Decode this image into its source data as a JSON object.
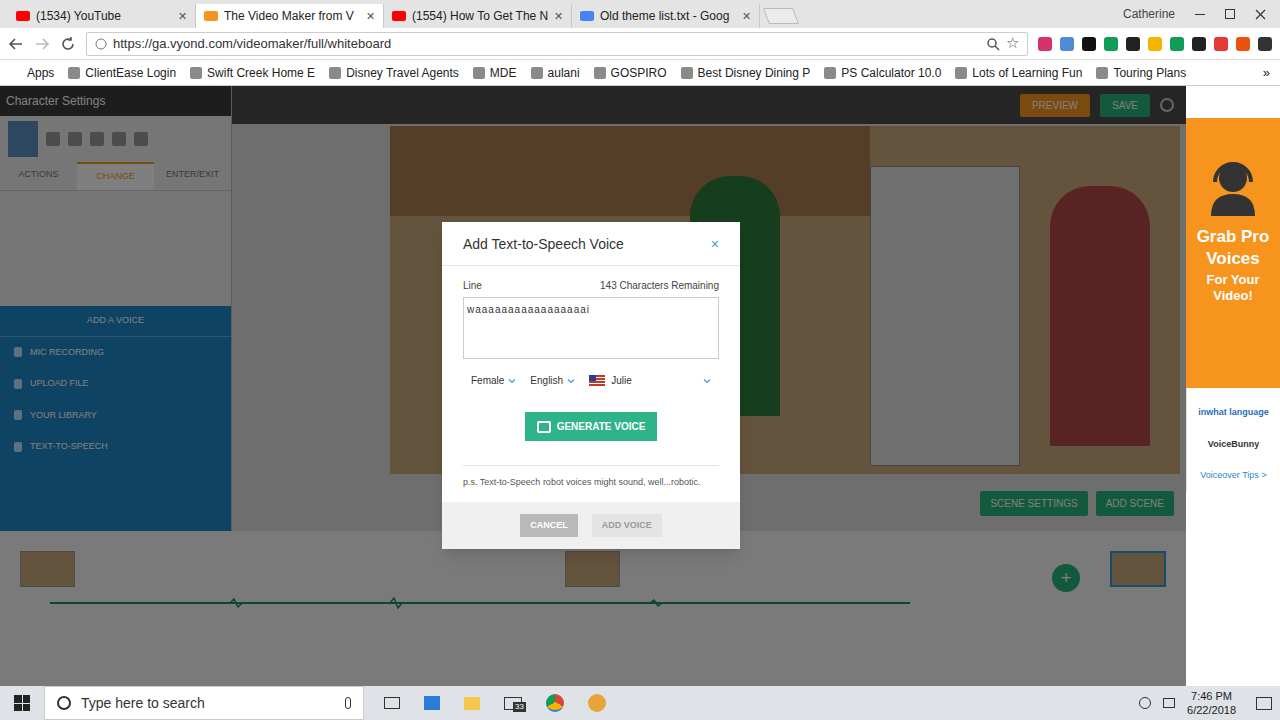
{
  "browser": {
    "tabs": [
      {
        "label": "(1534) YouTube",
        "selected": false
      },
      {
        "label": "The Video Maker from V",
        "selected": true
      },
      {
        "label": "(1554) How To Get The N",
        "selected": false
      },
      {
        "label": "Old theme list.txt - Goog",
        "selected": false
      }
    ],
    "profile": "Catherine",
    "url": "https://ga.vyond.com/videomaker/full/whiteboard",
    "bookmarks": [
      "Apps",
      "ClientEase Login",
      "Swift Creek Home E",
      "Disney Travel Agents",
      "MDE",
      "aulani",
      "GOSPIRO",
      "Best Disney Dining P",
      "PS Calculator 10.0",
      "Lots of Learning Fun",
      "Touring Plans"
    ],
    "more": "»"
  },
  "editor": {
    "panel_title": "Character Settings",
    "panel_tabs": [
      {
        "label": "ACTIONS",
        "selected": false
      },
      {
        "label": "CHANGE",
        "selected": true
      },
      {
        "label": "ENTER/EXIT",
        "selected": false
      }
    ],
    "voice_header": "ADD A VOICE",
    "voice_options": [
      "MIC RECORDING",
      "UPLOAD FILE",
      "YOUR LIBRARY",
      "TEXT-TO-SPEECH"
    ],
    "top_buttons": [
      "PREVIEW",
      "SAVE"
    ],
    "scene_buttons": [
      "SCENE SETTINGS",
      "ADD SCENE"
    ],
    "add_scene": "+",
    "scenes": [
      {
        "selected": false
      },
      {
        "selected": false
      },
      {
        "selected": true
      }
    ]
  },
  "dialog": {
    "title": "Add Text-to-Speech Voice",
    "close": "×",
    "line_label": "Line",
    "remaining": "143 Characters Remaining",
    "text": "waaaaaaaaaaaaaaaaai",
    "gender": "Female",
    "language": "English",
    "voice": "Julie",
    "generate": "GENERATE VOICE",
    "note": "p.s. Text-to-Speech robot voices might sound, well...robotic.",
    "cancel": "CANCEL",
    "add": {
      "label": "ADD VOICE",
      "disabled": true
    }
  },
  "ad": {
    "headline": "Grab Pro Voices",
    "sub": "For Your Video!",
    "partners": [
      "inwhat language",
      "VoiceBunny"
    ],
    "tips": "Voiceover Tips >"
  },
  "taskbar": {
    "search": "Type here to search",
    "mail_badge": "33",
    "time": "7:46 PM",
    "date": "6/22/2018"
  }
}
